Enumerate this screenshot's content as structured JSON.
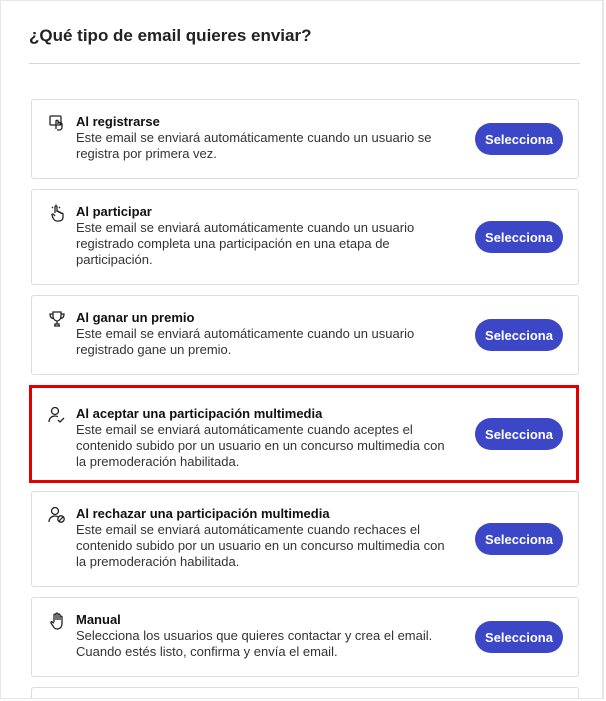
{
  "header": {
    "title": "¿Qué tipo de email quieres enviar?"
  },
  "button_label": "Selecciona",
  "options": [
    {
      "icon": "user-registration-icon",
      "name": "Al registrarse",
      "desc": "Este email se enviará automáticamente cuando un usuario se registra por primera vez."
    },
    {
      "icon": "hand-pointer-icon",
      "name": "Al participar",
      "desc": "Este email se enviará automáticamente cuando un usuario registrado completa una participación en una etapa de participación."
    },
    {
      "icon": "trophy-icon",
      "name": "Al ganar un premio",
      "desc": "Este email se enviará automáticamente cuando un usuario registrado gane un premio."
    },
    {
      "icon": "user-check-icon",
      "name": "Al aceptar una participación multimedia",
      "desc": "Este email se enviará automáticamente cuando aceptes el contenido subido por un usuario en un concurso multimedia con la premoderación habilitada."
    },
    {
      "icon": "user-block-icon",
      "name": "Al rechazar una participación multimedia",
      "desc": "Este email se enviará automáticamente cuando rechaces el contenido subido por un usuario en un concurso multimedia con la premoderación habilitada."
    },
    {
      "icon": "hand-manual-icon",
      "name": "Manual",
      "desc": "Selecciona los usuarios que quieres contactar y crea el email. Cuando estés listo, confirma y envía el email."
    }
  ],
  "colors": {
    "accent": "#3b47c7",
    "highlight": "#e00000"
  }
}
